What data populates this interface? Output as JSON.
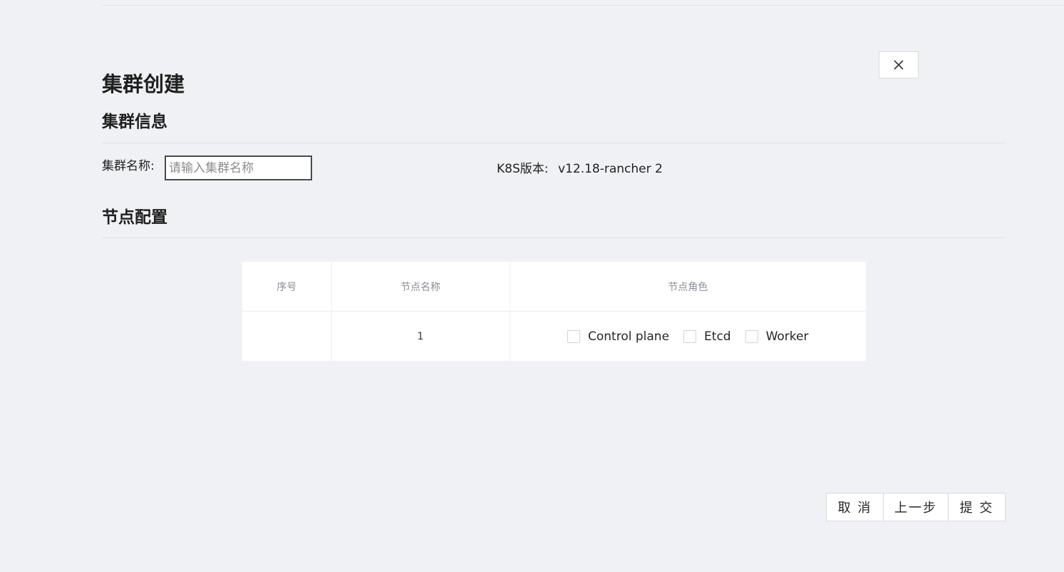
{
  "page": {
    "title": "集群创建",
    "close_icon": "close-icon"
  },
  "cluster_info": {
    "section_title": "集群信息",
    "name_label": "集群名称:",
    "name_value": "",
    "name_placeholder": "请输入集群名称",
    "k8s_label": "K8S版本:",
    "k8s_version": "v12.18-rancher 2"
  },
  "node_config": {
    "section_title": "节点配置",
    "table": {
      "columns": [
        "序号",
        "节点名称",
        "节点角色"
      ],
      "rows": [
        {
          "index": "",
          "name": "1",
          "roles": [
            {
              "label": "Control plane",
              "checked": false
            },
            {
              "label": "Etcd",
              "checked": false
            },
            {
              "label": "Worker",
              "checked": false
            }
          ]
        }
      ]
    }
  },
  "footer": {
    "cancel_label": "取 消",
    "prev_label": "上一步",
    "submit_label": "提 交"
  }
}
